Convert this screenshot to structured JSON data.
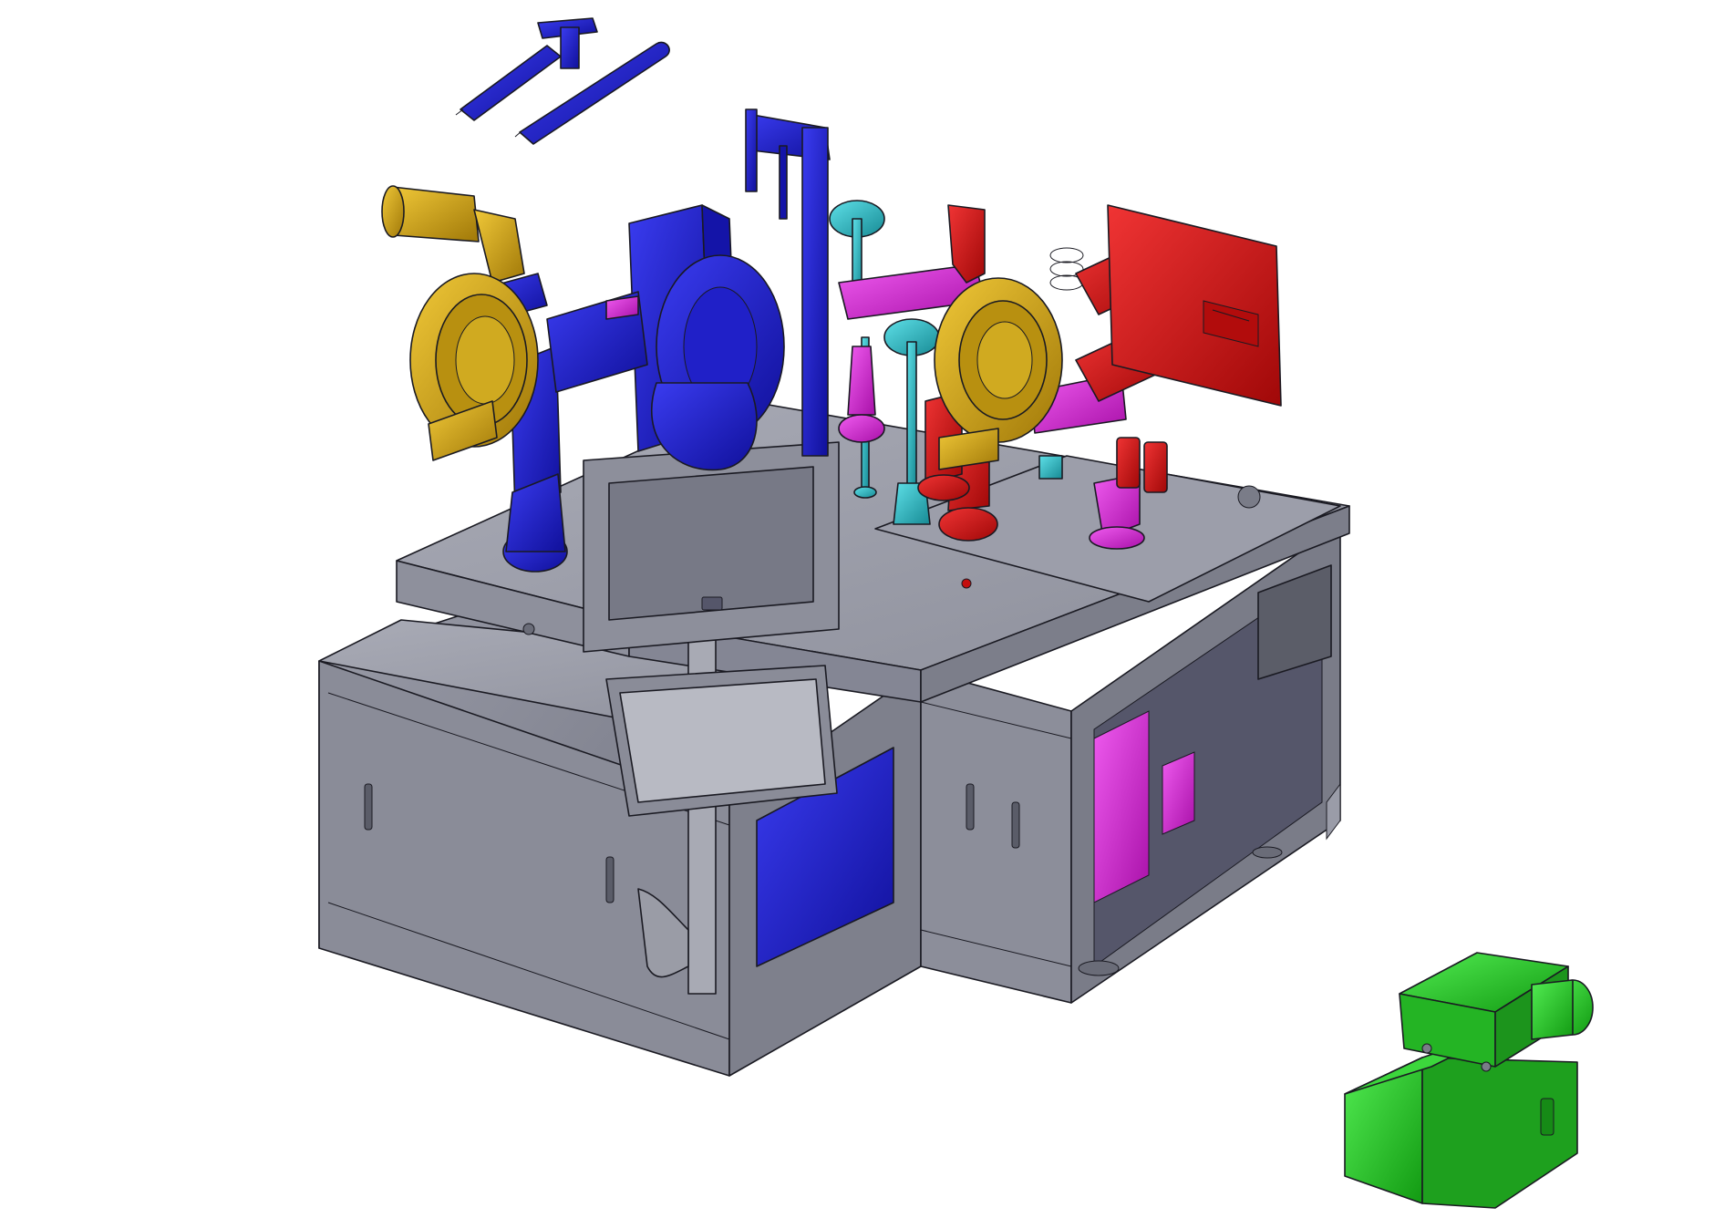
{
  "diagram": {
    "kind": "cad-isometric-assembly",
    "background": "#ffffff",
    "palette": {
      "frame": "#8a8c99",
      "frame_dark": "#6c6e7c",
      "frame_light": "#a3a5b1",
      "blue": "#1818c8",
      "yellow": "#d4a810",
      "red": "#d40f0f",
      "magenta": "#dd22dd",
      "cyan": "#22b8c4",
      "green": "#22d422",
      "screen": "#777986"
    },
    "components": [
      {
        "id": "base-frame",
        "color": "frame"
      },
      {
        "id": "upper-deck",
        "color": "frame"
      },
      {
        "id": "touch-monitor",
        "color": "screen"
      },
      {
        "id": "keyboard-panel",
        "color": "frame_light"
      },
      {
        "id": "blue-turret-unit",
        "color": "blue"
      },
      {
        "id": "blue-stylus-tools",
        "color": "blue"
      },
      {
        "id": "yellow-rotary-head",
        "color": "yellow"
      },
      {
        "id": "red-rotary-head",
        "color": "red"
      },
      {
        "id": "red-mounting-plate",
        "color": "red"
      },
      {
        "id": "magenta-fixtures",
        "color": "magenta"
      },
      {
        "id": "cyan-spindles",
        "color": "cyan"
      },
      {
        "id": "green-drive-unit",
        "color": "green"
      }
    ]
  }
}
